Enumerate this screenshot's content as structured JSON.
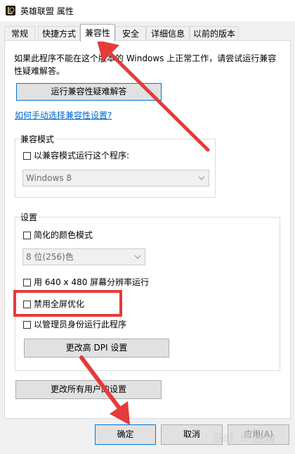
{
  "window": {
    "title": "英雄联盟 属性",
    "icon": "league-of-legends-icon"
  },
  "tabs": [
    {
      "label": "常规"
    },
    {
      "label": "快捷方式"
    },
    {
      "label": "兼容性",
      "active": true
    },
    {
      "label": "安全"
    },
    {
      "label": "详细信息"
    },
    {
      "label": "以前的版本"
    }
  ],
  "compat": {
    "intro": "如果此程序不能在这个版本的 Windows 上正常工作，请尝试运行兼容性疑难解答。",
    "troubleshoot_button": "运行兼容性疑难解答",
    "manual_link": "如何手动选择兼容性设置?"
  },
  "compat_mode": {
    "group_label": "兼容模式",
    "checkbox_label": "以兼容模式运行这个程序:",
    "checked": false,
    "os_select": "Windows 8"
  },
  "settings": {
    "group_label": "设置",
    "reduced_color": {
      "label": "简化的颜色模式",
      "checked": false
    },
    "color_select": "8 位(256)色",
    "run_640": {
      "label": "用 640 x 480 屏幕分辨率运行",
      "checked": false
    },
    "disable_fullscreen": {
      "label": "禁用全屏优化",
      "checked": false
    },
    "run_as_admin": {
      "label": "以管理员身份运行此程序",
      "checked": false
    },
    "dpi_button": "更改高 DPI 设置"
  },
  "all_users_button": "更改所有用户的设置",
  "footer": {
    "ok": "确定",
    "cancel": "取消",
    "apply": "应用(A)"
  },
  "watermark": {
    "text": "Baidu 经验"
  },
  "annotation": {
    "color": "#e53b3b"
  }
}
